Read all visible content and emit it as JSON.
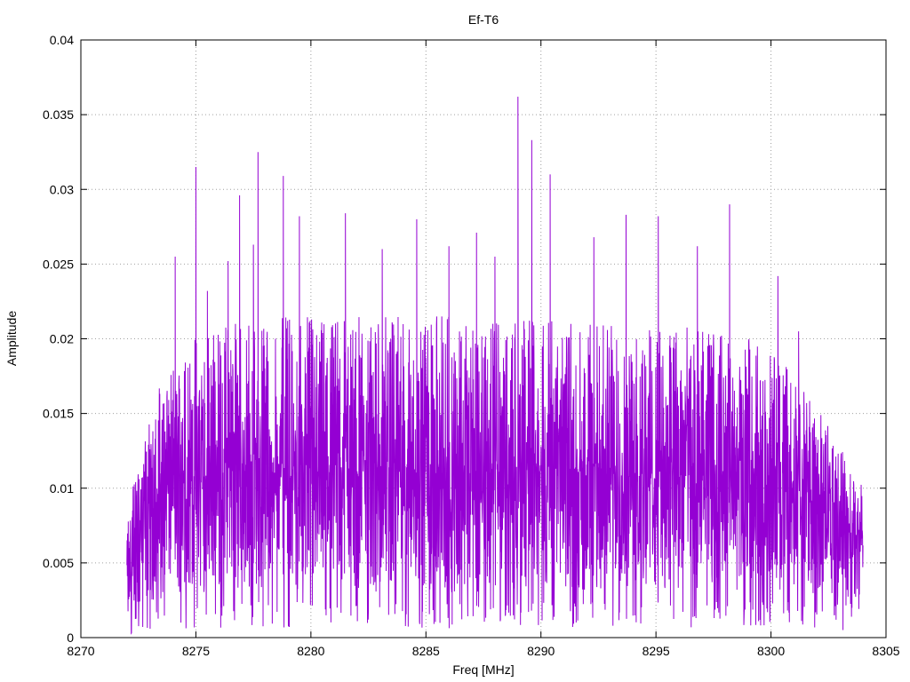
{
  "chart_data": {
    "type": "line",
    "title": "Ef-T6",
    "xlabel": "Freq [MHz]",
    "ylabel": "Amplitude",
    "xlim": [
      8270,
      8305
    ],
    "ylim": [
      0,
      0.04
    ],
    "grid": true,
    "legend": "none",
    "x_ticks": [
      8270,
      8275,
      8280,
      8285,
      8290,
      8295,
      8300,
      8305
    ],
    "x_tick_labels": [
      "8270",
      "8275",
      "8280",
      "8285",
      "8290",
      "8295",
      "8300",
      "8305"
    ],
    "y_ticks": [
      0,
      0.005,
      0.01,
      0.015,
      0.02,
      0.025,
      0.03,
      0.035,
      0.04
    ],
    "y_tick_labels": [
      "0",
      "0.005",
      "0.01",
      "0.015",
      "0.02",
      "0.025",
      "0.03",
      "0.035",
      "0.04"
    ],
    "series_color": "#9400d3",
    "series": [
      {
        "x_range": [
          8272.0,
          8304.0
        ],
        "envelope": {
          "x": [
            8272.0,
            8272.3,
            8272.6,
            8273.0,
            8273.5,
            8274.0,
            8275.0,
            8276.0,
            8278.0,
            8280.0,
            8283.0,
            8286.0,
            8289.0,
            8292.0,
            8295.0,
            8298.0,
            8300.0,
            8301.0,
            8302.0,
            8302.8,
            8303.3,
            8303.7,
            8304.0
          ],
          "low": [
            0.0005,
            0.001,
            0.0015,
            0.002,
            0.0025,
            0.003,
            0.003,
            0.003,
            0.003,
            0.003,
            0.003,
            0.003,
            0.003,
            0.003,
            0.003,
            0.003,
            0.003,
            0.003,
            0.0025,
            0.002,
            0.0015,
            0.001,
            0.001
          ],
          "center": [
            0.004,
            0.006,
            0.0075,
            0.0085,
            0.0095,
            0.01,
            0.0105,
            0.011,
            0.011,
            0.011,
            0.011,
            0.011,
            0.011,
            0.011,
            0.0105,
            0.0105,
            0.01,
            0.0095,
            0.009,
            0.008,
            0.007,
            0.0065,
            0.006
          ],
          "high": [
            0.008,
            0.011,
            0.013,
            0.015,
            0.0175,
            0.019,
            0.0205,
            0.021,
            0.0215,
            0.0215,
            0.0215,
            0.0215,
            0.0215,
            0.021,
            0.021,
            0.0205,
            0.0195,
            0.0175,
            0.0155,
            0.0135,
            0.012,
            0.011,
            0.01
          ]
        },
        "peaks": [
          {
            "x": 8274.1,
            "y": 0.0255
          },
          {
            "x": 8275.0,
            "y": 0.0315
          },
          {
            "x": 8275.5,
            "y": 0.0232
          },
          {
            "x": 8276.4,
            "y": 0.0252
          },
          {
            "x": 8276.9,
            "y": 0.0296
          },
          {
            "x": 8277.5,
            "y": 0.0263
          },
          {
            "x": 8277.7,
            "y": 0.0325
          },
          {
            "x": 8278.8,
            "y": 0.0309
          },
          {
            "x": 8279.5,
            "y": 0.0282
          },
          {
            "x": 8281.5,
            "y": 0.0284
          },
          {
            "x": 8283.1,
            "y": 0.026
          },
          {
            "x": 8284.6,
            "y": 0.028
          },
          {
            "x": 8286.0,
            "y": 0.0262
          },
          {
            "x": 8287.2,
            "y": 0.0271
          },
          {
            "x": 8288.0,
            "y": 0.0255
          },
          {
            "x": 8289.0,
            "y": 0.0362
          },
          {
            "x": 8289.6,
            "y": 0.0333
          },
          {
            "x": 8290.4,
            "y": 0.031
          },
          {
            "x": 8292.3,
            "y": 0.0268
          },
          {
            "x": 8293.7,
            "y": 0.0283
          },
          {
            "x": 8295.1,
            "y": 0.0282
          },
          {
            "x": 8296.8,
            "y": 0.0262
          },
          {
            "x": 8298.2,
            "y": 0.029
          },
          {
            "x": 8300.3,
            "y": 0.0242
          },
          {
            "x": 8301.2,
            "y": 0.0205
          }
        ]
      }
    ]
  }
}
